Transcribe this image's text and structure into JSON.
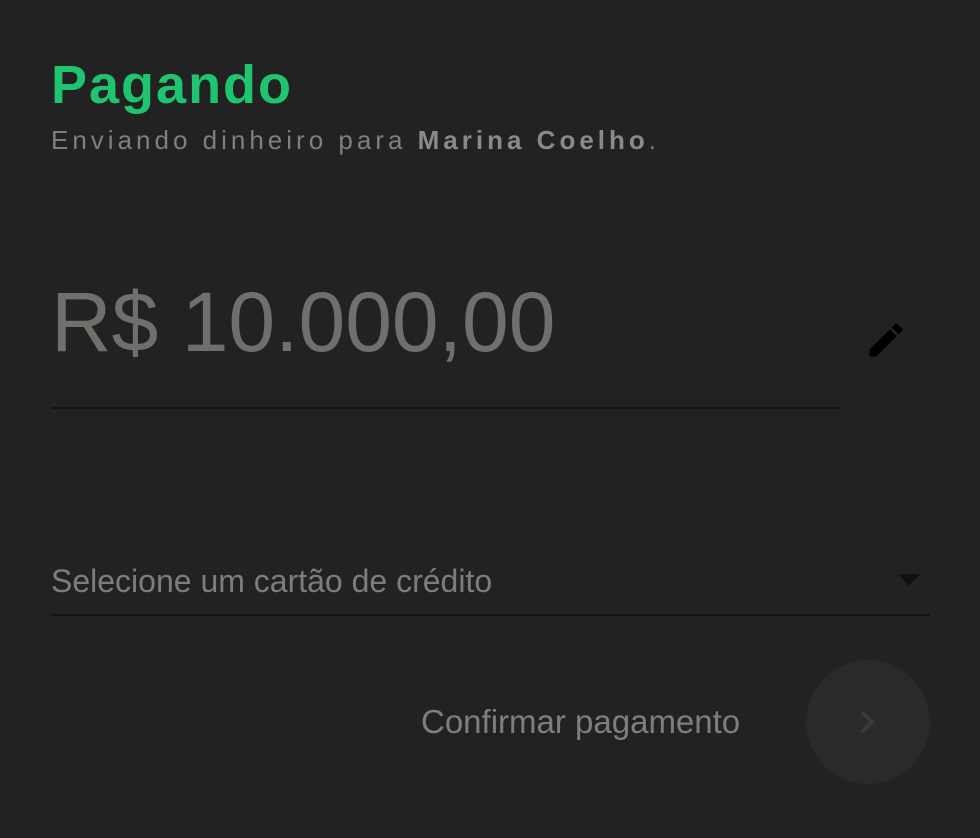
{
  "dialog": {
    "title": "Pagando",
    "subtitle_prefix": "Enviando dinheiro para ",
    "recipient": "Marina Coelho",
    "subtitle_suffix": "."
  },
  "amount": {
    "value": "R$ 10.000,00",
    "edit_icon": "pencil-icon"
  },
  "card_select": {
    "placeholder": "Selecione um cartão de crédito",
    "dropdown_icon": "caret-down-icon"
  },
  "confirm": {
    "label": "Confirmar pagamento",
    "button_icon": "chevron-right-icon"
  },
  "colors": {
    "accent": "#1ec46f",
    "background": "#222222",
    "text_muted": "#7a7a78"
  }
}
